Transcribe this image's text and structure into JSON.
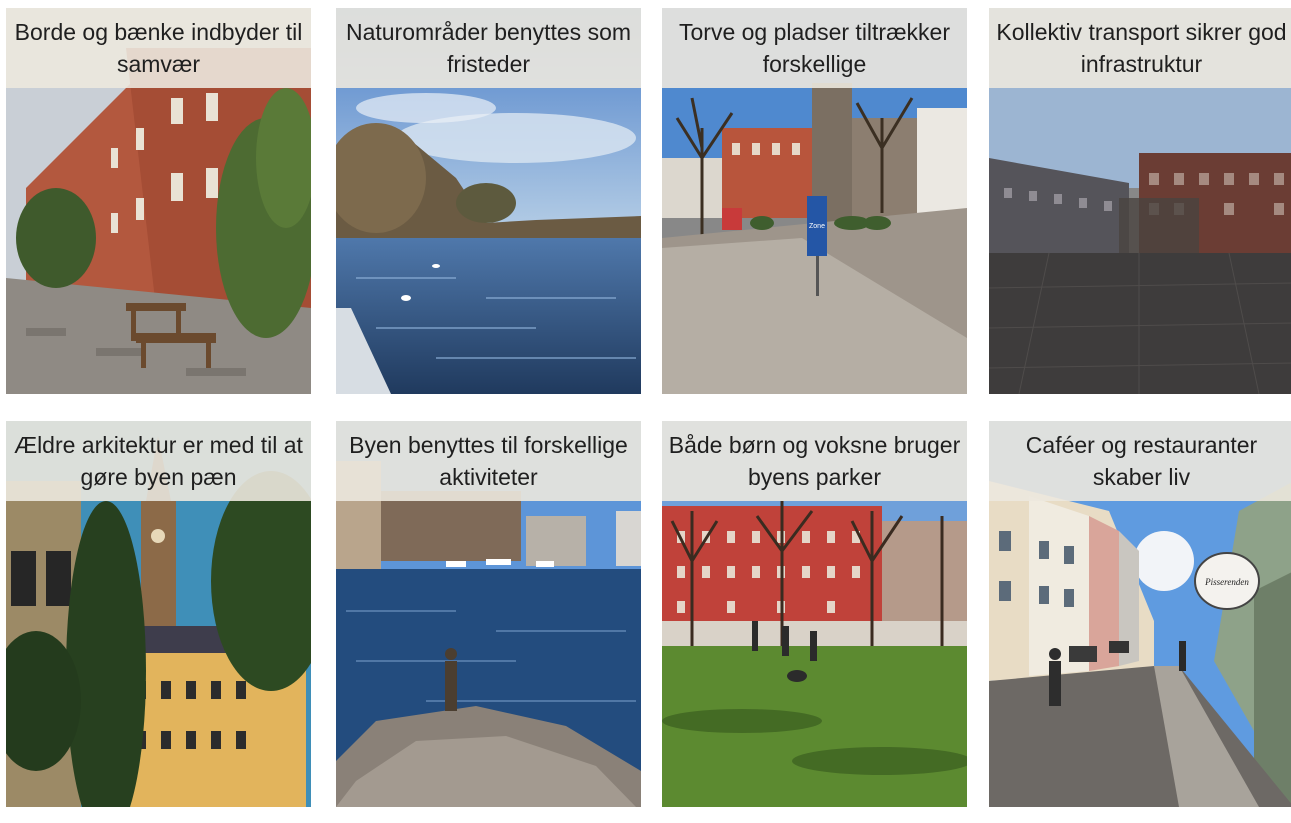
{
  "cards": [
    {
      "caption": "Borde og bænke indbyder til samvær",
      "scene": "brick-street-with-benches-photo"
    },
    {
      "caption": "Naturområder benyttes som fristeder",
      "scene": "lake-with-swans-photo"
    },
    {
      "caption": "Torve og pladser tiltrækker forskellige",
      "scene": "city-square-photo"
    },
    {
      "caption": "Kollektiv transport sikrer god infrastruktur",
      "scene": "open-plaza-photo"
    },
    {
      "caption": "Ældre arkitektur er med til at gøre byen pæn",
      "scene": "church-tower-photo"
    },
    {
      "caption": "Byen benyttes til forskellige aktiviteter",
      "scene": "harbour-angler-photo"
    },
    {
      "caption": "Både børn og voksne bruger byens parker",
      "scene": "city-park-photo"
    },
    {
      "caption": "Caféer og restauranter skaber liv",
      "scene": "shopping-street-photo"
    }
  ],
  "signs": {
    "street_sign": "Zone",
    "shop_sign": "Pisserenden"
  },
  "colors": {
    "caption_bg": "#ece8de",
    "caption_text": "#1f1f1f"
  }
}
